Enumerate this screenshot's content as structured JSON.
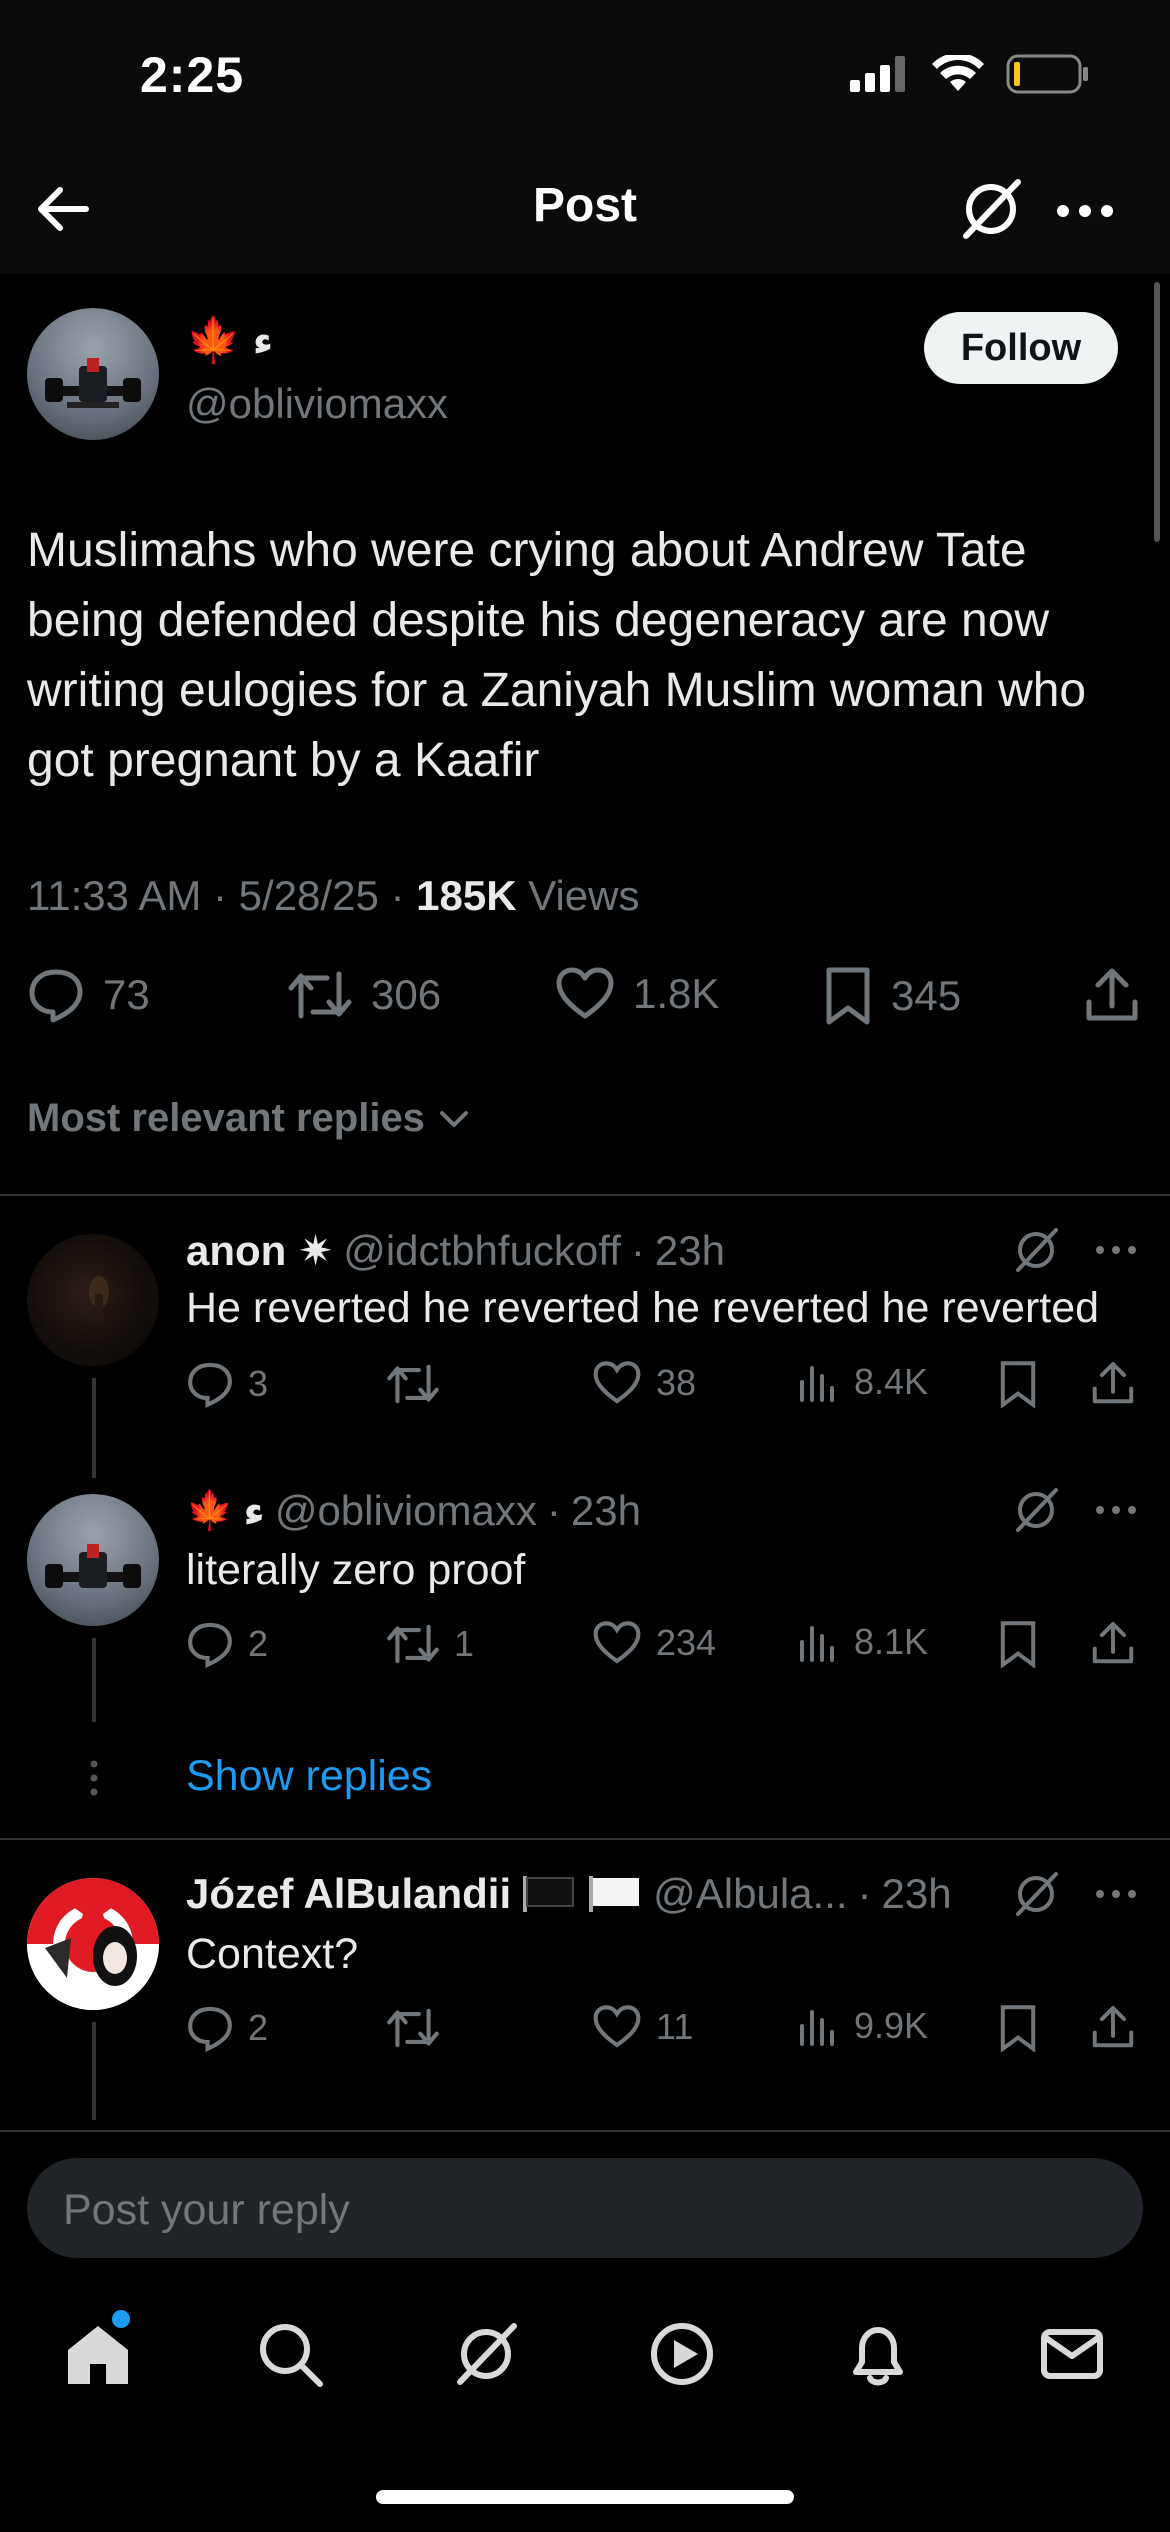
{
  "status": {
    "time": "2:25"
  },
  "nav": {
    "title": "Post"
  },
  "post": {
    "author_name_suffix": "ء",
    "handle": "@obliviomaxx",
    "follow_label": "Follow",
    "text": "Muslimahs who were crying about Andrew Tate being defended despite his degeneracy are now writing eulogies for a Zaniyah Muslim woman who got pregnant by a Kaafir",
    "time": "11:33 AM",
    "date": "5/28/25",
    "views_count": "185K",
    "views_label": "Views",
    "replies": "73",
    "reposts": "306",
    "likes": "1.8K",
    "bookmarks": "345"
  },
  "sort": {
    "label": "Most relevant replies"
  },
  "replies": [
    {
      "name": "anon ✷",
      "handle": "@idctbhfuckoff",
      "time": "23h",
      "text": "He reverted he reverted he reverted he reverted",
      "replies": "3",
      "reposts": "",
      "likes": "38",
      "views": "8.4K"
    },
    {
      "name": "ء",
      "handle": "@obliviomaxx",
      "time": "23h",
      "text": "literally zero proof",
      "replies": "2",
      "reposts": "1",
      "likes": "234",
      "views": "8.1K"
    },
    {
      "name": "Józef AlBulandii",
      "handle": "@Albula...",
      "time": "23h",
      "text": "Context?",
      "replies": "2",
      "reposts": "",
      "likes": "11",
      "views": "9.9K"
    }
  ],
  "show_replies_label": "Show replies",
  "composer": {
    "placeholder": "Post your reply"
  },
  "colors": {
    "accent": "#1d9bf0",
    "muted": "#71767b",
    "text": "#e7e9ea",
    "background": "#000000"
  },
  "icons": [
    "back-arrow-icon",
    "grok-icon",
    "more-icon",
    "reply-icon",
    "repost-icon",
    "like-icon",
    "bookmark-icon",
    "share-icon",
    "views-icon",
    "home-icon",
    "search-icon",
    "play-icon",
    "bell-icon",
    "mail-icon"
  ]
}
